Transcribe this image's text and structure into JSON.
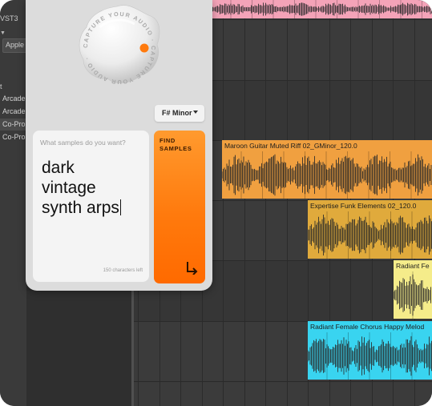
{
  "browser": {
    "format_label": "VST3",
    "vendor_box": "Apple",
    "section_label": "t",
    "items": [
      {
        "label": "Arcade"
      },
      {
        "label": "Arcade"
      },
      {
        "label": "Co-Pro"
      },
      {
        "label": "Co-Pro"
      }
    ],
    "selected_index": 2
  },
  "plugin": {
    "blob_ring_text": "CAPTURE YOUR AUDIO · CAPTURE YOUR AUDIO ·",
    "key": "F# Minor",
    "prompt_placeholder": "What samples do you want?",
    "prompt_text": "dark\nvintage\nsynth arps",
    "chars_left": "150 characters left",
    "find_label": "FIND\nSAMPLES",
    "accent": "#ff7a0d"
  },
  "clips": [
    {
      "name": "",
      "color": "#f4a3b8"
    },
    {
      "name": "Maroon Guitar Muted Riff 02_GMinor_120.0",
      "color": "#f0a040"
    },
    {
      "name": "Expertise Funk Elements 02_120.0",
      "color": "#e0aa3c"
    },
    {
      "name": "Radiant Fe",
      "color": "#f5ec8a"
    },
    {
      "name": "Radiant Female Chorus Happy Melod",
      "color": "#39d4f0"
    }
  ]
}
